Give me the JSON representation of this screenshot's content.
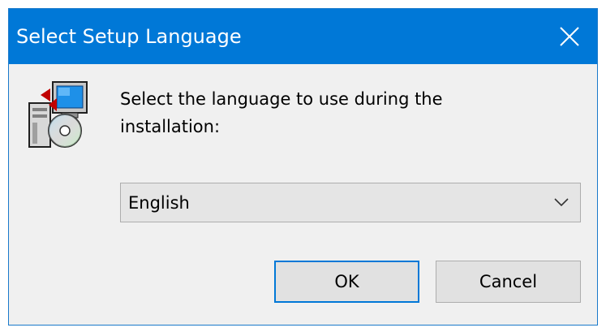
{
  "window": {
    "title": "Select Setup Language",
    "close_icon": "close-icon",
    "accent_color": "#0078d7"
  },
  "body": {
    "icon": "setup-installer-icon",
    "prompt": "Select the language to use during the installation:"
  },
  "language_select": {
    "selected": "English",
    "icon": "chevron-down-icon"
  },
  "buttons": {
    "ok_label": "OK",
    "cancel_label": "Cancel"
  }
}
